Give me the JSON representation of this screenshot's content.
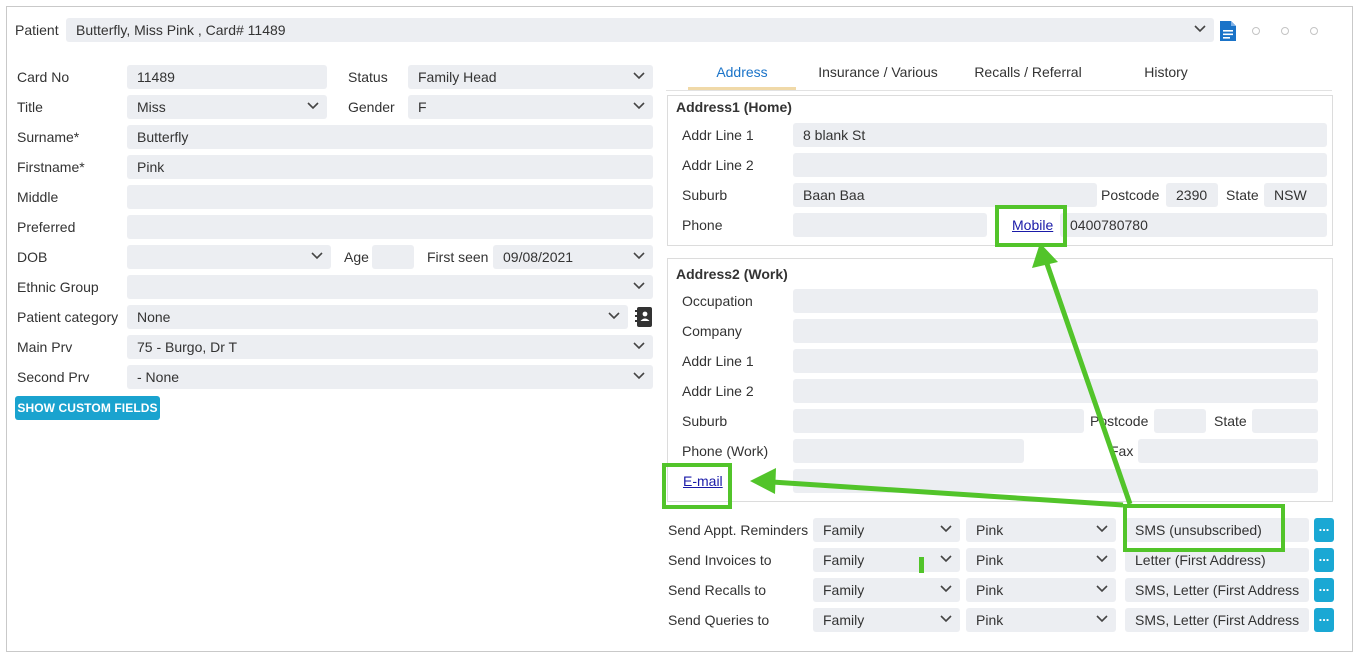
{
  "patient_bar": {
    "label": "Patient",
    "value": "Butterfly, Miss Pink , Card# 11489"
  },
  "left": {
    "card_no": {
      "label": "Card No",
      "value": "11489"
    },
    "status": {
      "label": "Status",
      "value": "Family Head"
    },
    "title": {
      "label": "Title",
      "value": "Miss"
    },
    "gender": {
      "label": "Gender",
      "value": "F"
    },
    "surname": {
      "label": "Surname*",
      "value": "Butterfly"
    },
    "firstname": {
      "label": "Firstname*",
      "value": "Pink"
    },
    "middle": {
      "label": "Middle",
      "value": ""
    },
    "preferred": {
      "label": "Preferred",
      "value": ""
    },
    "dob": {
      "label": "DOB",
      "value": ""
    },
    "age": {
      "label": "Age",
      "value": ""
    },
    "first_seen": {
      "label": "First seen",
      "value": "09/08/2021"
    },
    "ethnic_group": {
      "label": "Ethnic Group",
      "value": ""
    },
    "patient_category": {
      "label": "Patient category",
      "value": "None"
    },
    "main_prv": {
      "label": "Main Prv",
      "value": "75 - Burgo, Dr T"
    },
    "second_prv": {
      "label": "Second Prv",
      "value": "- None"
    },
    "custom_fields_button": "SHOW CUSTOM FIELDS"
  },
  "tabs": [
    "Address",
    "Insurance / Various",
    "Recalls / Referral",
    "History"
  ],
  "address1": {
    "title": "Address1 (Home)",
    "line1": {
      "label": "Addr Line 1",
      "value": "8 blank St"
    },
    "line2": {
      "label": "Addr Line 2",
      "value": ""
    },
    "suburb": {
      "label": "Suburb",
      "value": "Baan Baa"
    },
    "postcode": {
      "label": "Postcode",
      "value": "2390"
    },
    "state": {
      "label": "State",
      "value": "NSW"
    },
    "phone": {
      "label": "Phone",
      "value": ""
    },
    "mobile": {
      "label": "Mobile",
      "value": "0400780780"
    }
  },
  "address2": {
    "title": "Address2 (Work)",
    "occupation": {
      "label": "Occupation",
      "value": ""
    },
    "company": {
      "label": "Company",
      "value": ""
    },
    "line1": {
      "label": "Addr Line 1",
      "value": ""
    },
    "line2": {
      "label": "Addr Line 2",
      "value": ""
    },
    "suburb": {
      "label": "Suburb",
      "value": ""
    },
    "postcode": {
      "label": "Postcode",
      "value": ""
    },
    "state": {
      "label": "State",
      "value": ""
    },
    "phone_work": {
      "label": "Phone (Work)",
      "value": ""
    },
    "fax": {
      "label": "Fax",
      "value": ""
    },
    "email": {
      "label": "E-mail",
      "value": ""
    }
  },
  "send": [
    {
      "label": "Send Appt. Reminders",
      "to": "Family",
      "who": "Pink",
      "method": "SMS (unsubscribed)"
    },
    {
      "label": "Send Invoices to",
      "to": "Family",
      "who": "Pink",
      "method": "Letter (First Address)"
    },
    {
      "label": "Send Recalls to",
      "to": "Family",
      "who": "Pink",
      "method": "SMS, Letter (First Address"
    },
    {
      "label": "Send Queries to",
      "to": "Family",
      "who": "Pink",
      "method": "SMS, Letter (First Address"
    }
  ],
  "more_button_label": "...",
  "colors": {
    "accent_blue": "#1a73c8",
    "button_cyan": "#1aa3cf",
    "annotation_green": "#52c42a",
    "field_bg": "#eceef2"
  },
  "icons": [
    "document-icon",
    "contacts-book-icon",
    "chevron-down-icon"
  ]
}
